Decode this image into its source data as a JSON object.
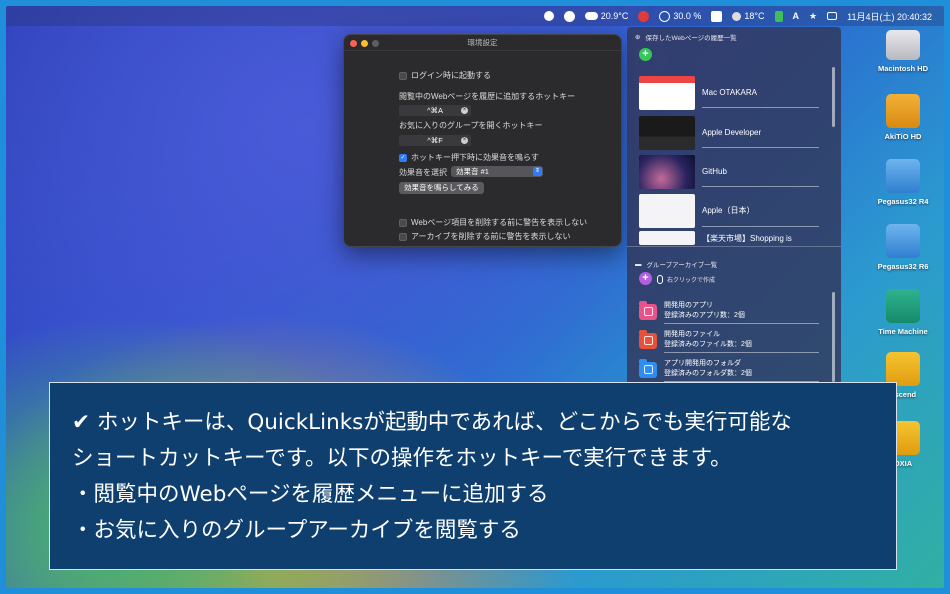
{
  "menubar": {
    "items": [
      {
        "icon": "app-icon",
        "text": ""
      },
      {
        "icon": "badge-icon",
        "text": ""
      },
      {
        "icon": "cloud-icon",
        "text": "20.9°C"
      },
      {
        "icon": "link-icon",
        "text": ""
      },
      {
        "icon": "cpu-icon",
        "text": "30.0 %"
      },
      {
        "icon": "calendar-icon",
        "text": ""
      },
      {
        "icon": "weather-icon",
        "text": "18°C"
      },
      {
        "icon": "battery-icon",
        "text": ""
      },
      {
        "icon": "text-icon",
        "text": ""
      },
      {
        "icon": "star-icon",
        "text": ""
      },
      {
        "icon": "control-center-icon",
        "text": ""
      }
    ],
    "datetime": "11月4日(土) 20:40:32"
  },
  "settings": {
    "window_title": "環境設定",
    "launch_at_login": "ログイン時に起動する",
    "hotkey_add_label": "閲覧中のWebページを履歴に追加するホットキー",
    "hotkey_add_value": "^⌘A",
    "hotkey_group_label": "お気に入りのグループを開くホットキー",
    "hotkey_group_value": "^⌘F",
    "sound_on_hotkey": "ホットキー押下時に効果音を鳴らす",
    "sound_select_label": "効果音を選択",
    "sound_select_value": "効果音 #1",
    "play_sound_button": "効果音を鳴らしてみる",
    "warn_delete_web": "Webページ項目を削除する前に警告を表示しない",
    "warn_delete_archive": "アーカイブを削除する前に警告を表示しない",
    "checked": {
      "launch_at_login": false,
      "sound_on_hotkey": true,
      "warn_delete_web": false,
      "warn_delete_archive": false
    }
  },
  "panel": {
    "history_header": "保存したWebページの履歴一覧",
    "history_items": [
      {
        "label": "Mac OTAKARA"
      },
      {
        "label": "Apple Developer"
      },
      {
        "label": "GitHub"
      },
      {
        "label": "Apple（日本）"
      },
      {
        "label": "【楽天市場】Shopping is"
      }
    ],
    "archive_header": "グループアーカイブ一覧",
    "archive_hint": "右クリックで作成",
    "archive_items": [
      {
        "title": "開発用のアプリ",
        "sub": "登録済みのアプリ数：2個",
        "color": "#e8538a"
      },
      {
        "title": "開発用のファイル",
        "sub": "登録済みのファイル数：2個",
        "color": "#e8503a"
      },
      {
        "title": "アプリ開発用のフォルダ",
        "sub": "登録済みのフォルダ数：2個",
        "color": "#2f8ef0"
      }
    ],
    "accent_green": "#35c759",
    "accent_purple": "#b45ee0"
  },
  "desktop": {
    "icons": [
      {
        "label": "Macintosh HD",
        "icon": "internal-disk-icon"
      },
      {
        "label": "AkiTiO HD",
        "icon": "external-disk-icon"
      },
      {
        "label": "Pegasus32 R4",
        "icon": "raid-disk-icon"
      },
      {
        "label": "Pegasus32 R6",
        "icon": "raid-disk-icon"
      },
      {
        "label": "Time Machine",
        "icon": "time-machine-icon"
      },
      {
        "label": "nscend",
        "icon": "transcend-disk-icon"
      },
      {
        "label": "OXIA",
        "icon": "yellow-disk-icon"
      }
    ]
  },
  "caption": {
    "lines": [
      "✔ ホットキーは、QuickLinksが起動中であれば、どこからでも実行可能な",
      "ショートカットキーです。以下の操作をホットキーで実行できます。",
      "・閲覧中のWebページを履歴メニューに追加する",
      "・お気に入りのグループアーカイブを閲覧する"
    ]
  }
}
